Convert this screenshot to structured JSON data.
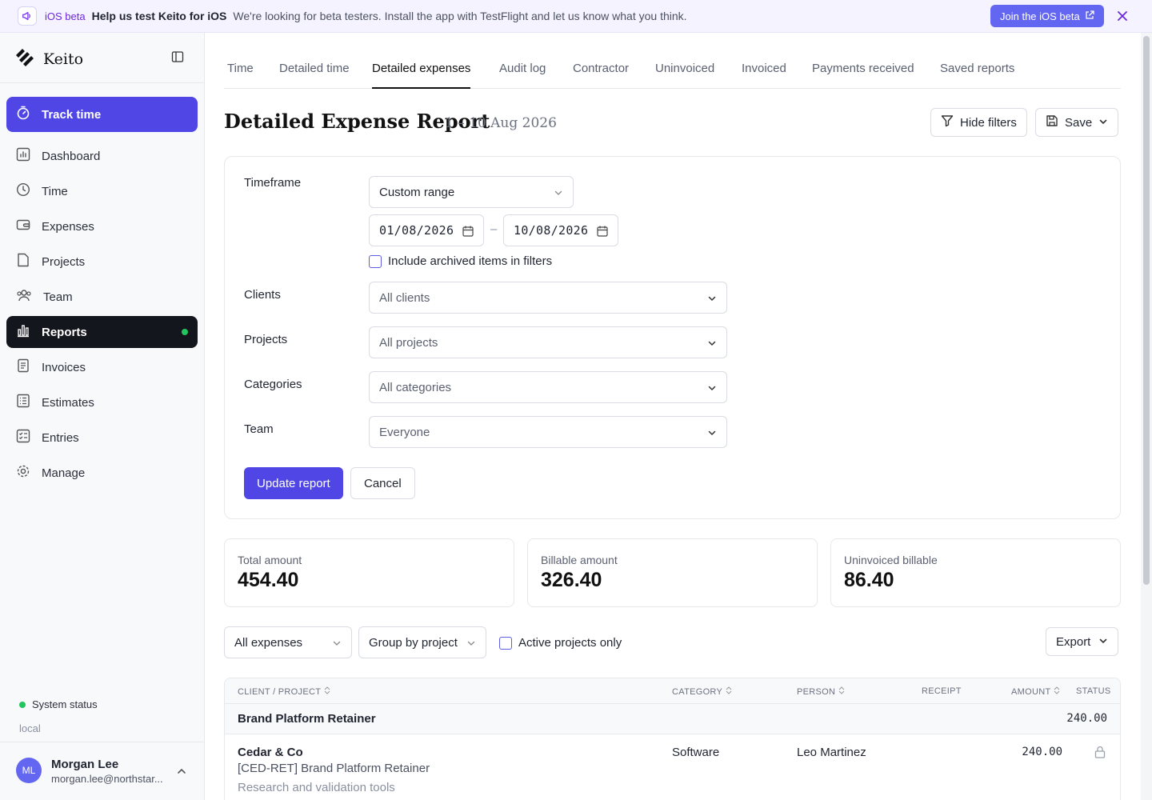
{
  "banner": {
    "badge": "iOS beta",
    "title": "Help us test Keito for iOS",
    "text": "We're looking for beta testers. Install the app with TestFlight and let us know what you think.",
    "cta": "Join the iOS beta"
  },
  "sidebar": {
    "brand": "Keito",
    "track_time": "Track time",
    "items": [
      {
        "label": "Dashboard",
        "icon": "dashboard-icon"
      },
      {
        "label": "Time",
        "icon": "clock-icon"
      },
      {
        "label": "Expenses",
        "icon": "wallet-icon"
      },
      {
        "label": "Projects",
        "icon": "folder-icon"
      },
      {
        "label": "Team",
        "icon": "team-icon"
      },
      {
        "label": "Reports",
        "icon": "bar-chart-icon",
        "active": true
      },
      {
        "label": "Invoices",
        "icon": "invoice-icon"
      },
      {
        "label": "Estimates",
        "icon": "estimate-icon"
      },
      {
        "label": "Entries",
        "icon": "entries-icon"
      },
      {
        "label": "Manage",
        "icon": "gear-icon"
      }
    ],
    "system_status": "System status",
    "environment": "local",
    "user": {
      "initials": "ML",
      "name": "Morgan Lee",
      "email": "morgan.lee@northstar..."
    }
  },
  "tabs": [
    "Time",
    "Detailed time",
    "Detailed expenses",
    "Audit log",
    "Contractor",
    "Uninvoiced",
    "Invoiced",
    "Payments received",
    "Saved reports"
  ],
  "active_tab": "Detailed expenses",
  "page": {
    "title": "Detailed Expense Report",
    "range": "1 – 10 Aug 2026",
    "hide_filters": "Hide filters",
    "save": "Save"
  },
  "filters": {
    "timeframe_label": "Timeframe",
    "timeframe_value": "Custom range",
    "date_from": "01/08/2026",
    "date_separator": "–",
    "date_to": "10/08/2026",
    "include_archived": "Include archived items in filters",
    "clients_label": "Clients",
    "clients_value": "All clients",
    "projects_label": "Projects",
    "projects_value": "All projects",
    "categories_label": "Categories",
    "categories_value": "All categories",
    "team_label": "Team",
    "team_value": "Everyone",
    "update": "Update report",
    "cancel": "Cancel"
  },
  "stats": [
    {
      "label": "Total amount",
      "value": "454.40"
    },
    {
      "label": "Billable amount",
      "value": "326.40"
    },
    {
      "label": "Uninvoiced billable",
      "value": "86.40"
    }
  ],
  "toolbar": {
    "expenses_filter": "All expenses",
    "group_by": "Group by project",
    "active_only": "Active projects only",
    "export": "Export"
  },
  "table": {
    "columns": [
      "CLIENT / PROJECT",
      "CATEGORY",
      "PERSON",
      "RECEIPT",
      "AMOUNT",
      "STATUS"
    ],
    "group": {
      "title": "Brand Platform Retainer",
      "total": "240.00"
    },
    "rows": [
      {
        "client": "Cedar & Co",
        "project": "[CED-RET] Brand Platform Retainer",
        "note": "Research and validation tools",
        "category": "Software",
        "person": "Leo Martinez",
        "amount": "240.00",
        "status_icon": "lock-icon"
      }
    ]
  },
  "colors": {
    "accent": "#4f46e5",
    "banner_bg": "#f5f3ff",
    "active_nav": "#14161d",
    "status_green": "#22c55e"
  }
}
